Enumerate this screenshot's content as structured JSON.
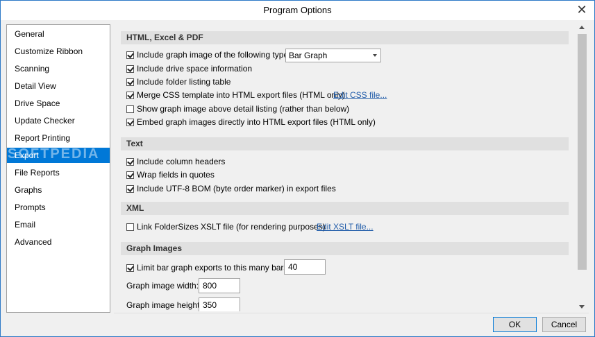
{
  "window": {
    "title": "Program Options"
  },
  "nav": {
    "items": [
      {
        "label": "General"
      },
      {
        "label": "Customize Ribbon"
      },
      {
        "label": "Scanning"
      },
      {
        "label": "Detail View"
      },
      {
        "label": "Drive Space"
      },
      {
        "label": "Update Checker"
      },
      {
        "label": "Report Printing"
      },
      {
        "label": "Export",
        "selected": true
      },
      {
        "label": "File Reports"
      },
      {
        "label": "Graphs"
      },
      {
        "label": "Prompts"
      },
      {
        "label": "Email"
      },
      {
        "label": "Advanced"
      }
    ]
  },
  "sections": {
    "html": {
      "title": "HTML, Excel & PDF",
      "graph_image": {
        "label": "Include graph image of the following type:",
        "checked": true,
        "value": "Bar Graph"
      },
      "drive_space": {
        "label": "Include drive space information",
        "checked": true
      },
      "folder_table": {
        "label": "Include folder listing table",
        "checked": true
      },
      "merge_css": {
        "label": "Merge CSS template into HTML export files (HTML only)",
        "checked": true,
        "link": "Edit CSS file..."
      },
      "graph_above": {
        "label": "Show graph image above detail listing (rather than below)",
        "checked": false
      },
      "embed_graph": {
        "label": "Embed graph images directly into HTML export files (HTML only)",
        "checked": true
      }
    },
    "text": {
      "title": "Text",
      "column_headers": {
        "label": "Include column headers",
        "checked": true
      },
      "wrap_quotes": {
        "label": "Wrap fields in quotes",
        "checked": true
      },
      "utf8_bom": {
        "label": "Include UTF-8 BOM (byte order marker) in export files",
        "checked": true
      }
    },
    "xml": {
      "title": "XML",
      "link_xslt": {
        "label": "Link FolderSizes XSLT file (for rendering purposes)",
        "checked": false,
        "link": "Edit XSLT file..."
      }
    },
    "graph_images": {
      "title": "Graph Images",
      "limit_bars": {
        "label": "Limit bar graph exports to this many bars:",
        "checked": true,
        "value": "40"
      },
      "width": {
        "label": "Graph image width:",
        "value": "800"
      },
      "height": {
        "label": "Graph image height:",
        "value": "350"
      }
    }
  },
  "buttons": {
    "ok": "OK",
    "cancel": "Cancel"
  },
  "watermark": "SOFTPEDIA"
}
